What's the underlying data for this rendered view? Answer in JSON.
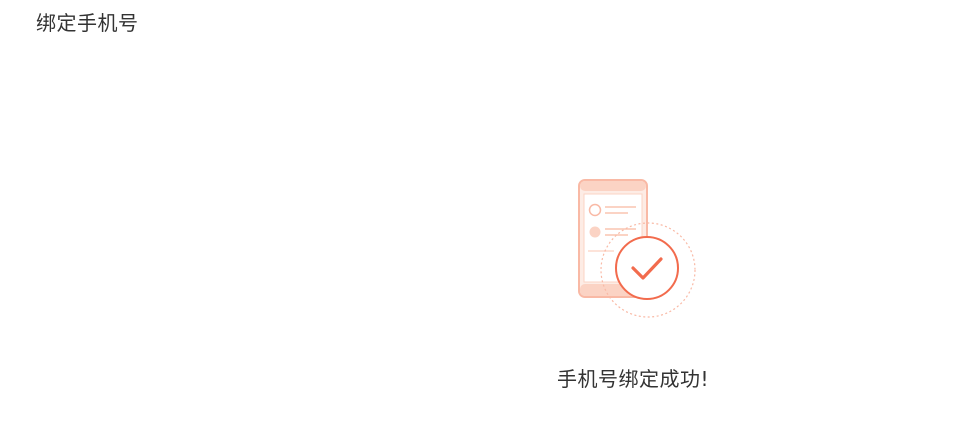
{
  "header": {
    "title": "绑定手机号"
  },
  "result": {
    "message": "手机号绑定成功!",
    "illustration_icon": "phone-success-check-icon"
  },
  "colors": {
    "accent": "#f26b4d",
    "accent_light": "#fde3d9",
    "accent_soft": "#f9b9a5",
    "text": "#333333"
  }
}
